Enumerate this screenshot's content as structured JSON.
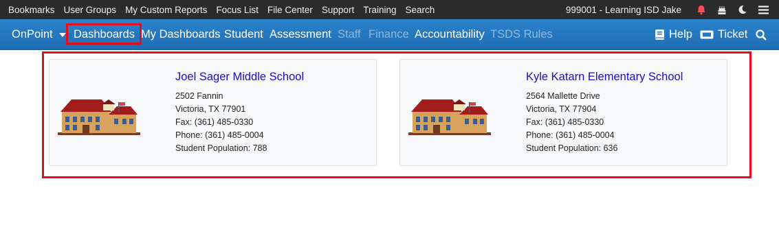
{
  "topbar": {
    "links": [
      "Bookmarks",
      "User Groups",
      "My Custom Reports",
      "Focus List",
      "File Center",
      "Support",
      "Training",
      "Search"
    ],
    "user": "999001 - Learning ISD Jake",
    "icons": [
      "bell-icon",
      "birthday-cake-icon",
      "moon-icon",
      "hamburger-menu-icon"
    ]
  },
  "nav": {
    "brand": "OnPoint",
    "items": [
      {
        "label": "Dashboards",
        "enabled": true
      },
      {
        "label": "My Dashboards",
        "enabled": true
      },
      {
        "label": "Student",
        "enabled": true
      },
      {
        "label": "Assessment",
        "enabled": true
      },
      {
        "label": "Staff",
        "enabled": false
      },
      {
        "label": "Finance",
        "enabled": false
      },
      {
        "label": "Accountability",
        "enabled": true
      },
      {
        "label": "TSDS Rules",
        "enabled": false
      }
    ],
    "help": "Help",
    "ticket": "Ticket"
  },
  "colors": {
    "topbar_bg": "#2b2b2b",
    "nav_bg": "#2479c2",
    "highlight_outline": "#e01020",
    "school_link": "#1a0dbf",
    "bell": "#ff4d4d"
  },
  "schools": [
    {
      "name": "Joel Sager Middle School",
      "address": "2502 Fannin",
      "city": "Victoria, TX 77901",
      "fax": "Fax: (361) 485-0330",
      "phone": "Phone: (361) 485-0004",
      "population": "Student Population: 788"
    },
    {
      "name": "Kyle Katarn Elementary School",
      "address": "2564 Mallette Drive",
      "city": "Victoria, TX 77904",
      "fax": "Fax: (361) 485-0330",
      "phone": "Phone: (361) 485-0004",
      "population": "Student Population: 636"
    }
  ]
}
